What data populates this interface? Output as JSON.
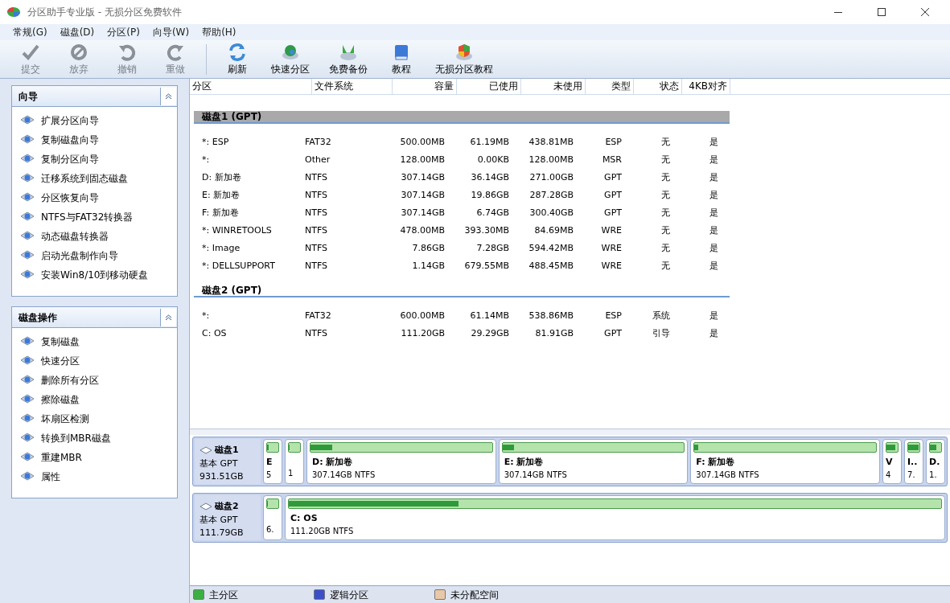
{
  "window": {
    "title": "分区助手专业版 - 无损分区免费软件"
  },
  "menu": [
    "常规(G)",
    "磁盘(D)",
    "分区(P)",
    "向导(W)",
    "帮助(H)"
  ],
  "toolbar": [
    {
      "label": "提交",
      "disabled": true
    },
    {
      "label": "放弃",
      "disabled": true
    },
    {
      "label": "撤销",
      "disabled": true
    },
    {
      "label": "重做",
      "disabled": true
    },
    {
      "label": "刷新",
      "disabled": false
    },
    {
      "label": "快速分区",
      "disabled": false
    },
    {
      "label": "免费备份",
      "disabled": false
    },
    {
      "label": "教程",
      "disabled": false
    },
    {
      "label": "无损分区教程",
      "disabled": false
    }
  ],
  "sidebar": [
    {
      "title": "向导",
      "expanded": true,
      "items": [
        "扩展分区向导",
        "复制磁盘向导",
        "复制分区向导",
        "迁移系统到固态磁盘",
        "分区恢复向导",
        "NTFS与FAT32转换器",
        "动态磁盘转换器",
        "启动光盘制作向导",
        "安装Win8/10到移动硬盘"
      ]
    },
    {
      "title": "磁盘操作",
      "expanded": true,
      "items": [
        "复制磁盘",
        "快速分区",
        "删除所有分区",
        "擦除磁盘",
        "坏扇区检测",
        "转换到MBR磁盘",
        "重建MBR",
        "属性"
      ]
    }
  ],
  "table": {
    "columns": [
      "分区",
      "文件系统",
      "容量",
      "已使用",
      "未使用",
      "类型",
      "状态",
      "4KB对齐"
    ],
    "groups": [
      {
        "title": "磁盘1 (GPT)",
        "selected": true,
        "rows": [
          [
            "*: ESP",
            "FAT32",
            "500.00MB",
            "61.19MB",
            "438.81MB",
            "ESP",
            "无",
            "是"
          ],
          [
            "*:",
            "Other",
            "128.00MB",
            "0.00KB",
            "128.00MB",
            "MSR",
            "无",
            "是"
          ],
          [
            "D: 新加卷",
            "NTFS",
            "307.14GB",
            "36.14GB",
            "271.00GB",
            "GPT",
            "无",
            "是"
          ],
          [
            "E: 新加卷",
            "NTFS",
            "307.14GB",
            "19.86GB",
            "287.28GB",
            "GPT",
            "无",
            "是"
          ],
          [
            "F: 新加卷",
            "NTFS",
            "307.14GB",
            "6.74GB",
            "300.40GB",
            "GPT",
            "无",
            "是"
          ],
          [
            "*: WINRETOOLS",
            "NTFS",
            "478.00MB",
            "393.30MB",
            "84.69MB",
            "WRE",
            "无",
            "是"
          ],
          [
            "*: Image",
            "NTFS",
            "7.86GB",
            "7.28GB",
            "594.42MB",
            "WRE",
            "无",
            "是"
          ],
          [
            "*: DELLSUPPORT",
            "NTFS",
            "1.14GB",
            "679.55MB",
            "488.45MB",
            "WRE",
            "无",
            "是"
          ]
        ]
      },
      {
        "title": "磁盘2 (GPT)",
        "selected": false,
        "rows": [
          [
            "*:",
            "FAT32",
            "600.00MB",
            "61.14MB",
            "538.86MB",
            "ESP",
            "系统",
            "是"
          ],
          [
            "C: OS",
            "NTFS",
            "111.20GB",
            "29.29GB",
            "81.91GB",
            "GPT",
            "引导",
            "是"
          ]
        ]
      }
    ]
  },
  "disks": [
    {
      "name": "磁盘1",
      "type": "基本 GPT",
      "size": "931.51GB",
      "partitions": [
        {
          "kind": "narrow",
          "name": "E",
          "info": "5",
          "level": 0.12
        },
        {
          "kind": "narrow",
          "info": "1",
          "level": 0.0
        },
        {
          "kind": "wide",
          "name": "D: 新加卷",
          "info": "307.14GB NTFS",
          "level": 0.12
        },
        {
          "kind": "wide",
          "name": "E: 新加卷",
          "info": "307.14GB NTFS",
          "level": 0.065
        },
        {
          "kind": "wide",
          "name": "F: 新加卷",
          "info": "307.14GB NTFS",
          "level": 0.022
        },
        {
          "kind": "narrow",
          "name": "V",
          "info": "4",
          "level": 0.82
        },
        {
          "kind": "narrow",
          "name": "I..",
          "info": "7.",
          "level": 0.93
        },
        {
          "kind": "narrow",
          "name": "D.",
          "info": "1.",
          "level": 0.58
        }
      ]
    },
    {
      "name": "磁盘2",
      "type": "基本 GPT",
      "size": "111.79GB",
      "partitions": [
        {
          "kind": "narrow",
          "info": "6.",
          "level": 0.1
        },
        {
          "kind": "wide",
          "name": "C: OS",
          "info": "111.20GB NTFS",
          "level": 0.26
        }
      ]
    }
  ],
  "legend": [
    {
      "label": "主分区",
      "color": "#3cb043"
    },
    {
      "label": "逻辑分区",
      "color": "#3a4fc8"
    },
    {
      "label": "未分配空间",
      "color": "#e8c8a8"
    }
  ]
}
